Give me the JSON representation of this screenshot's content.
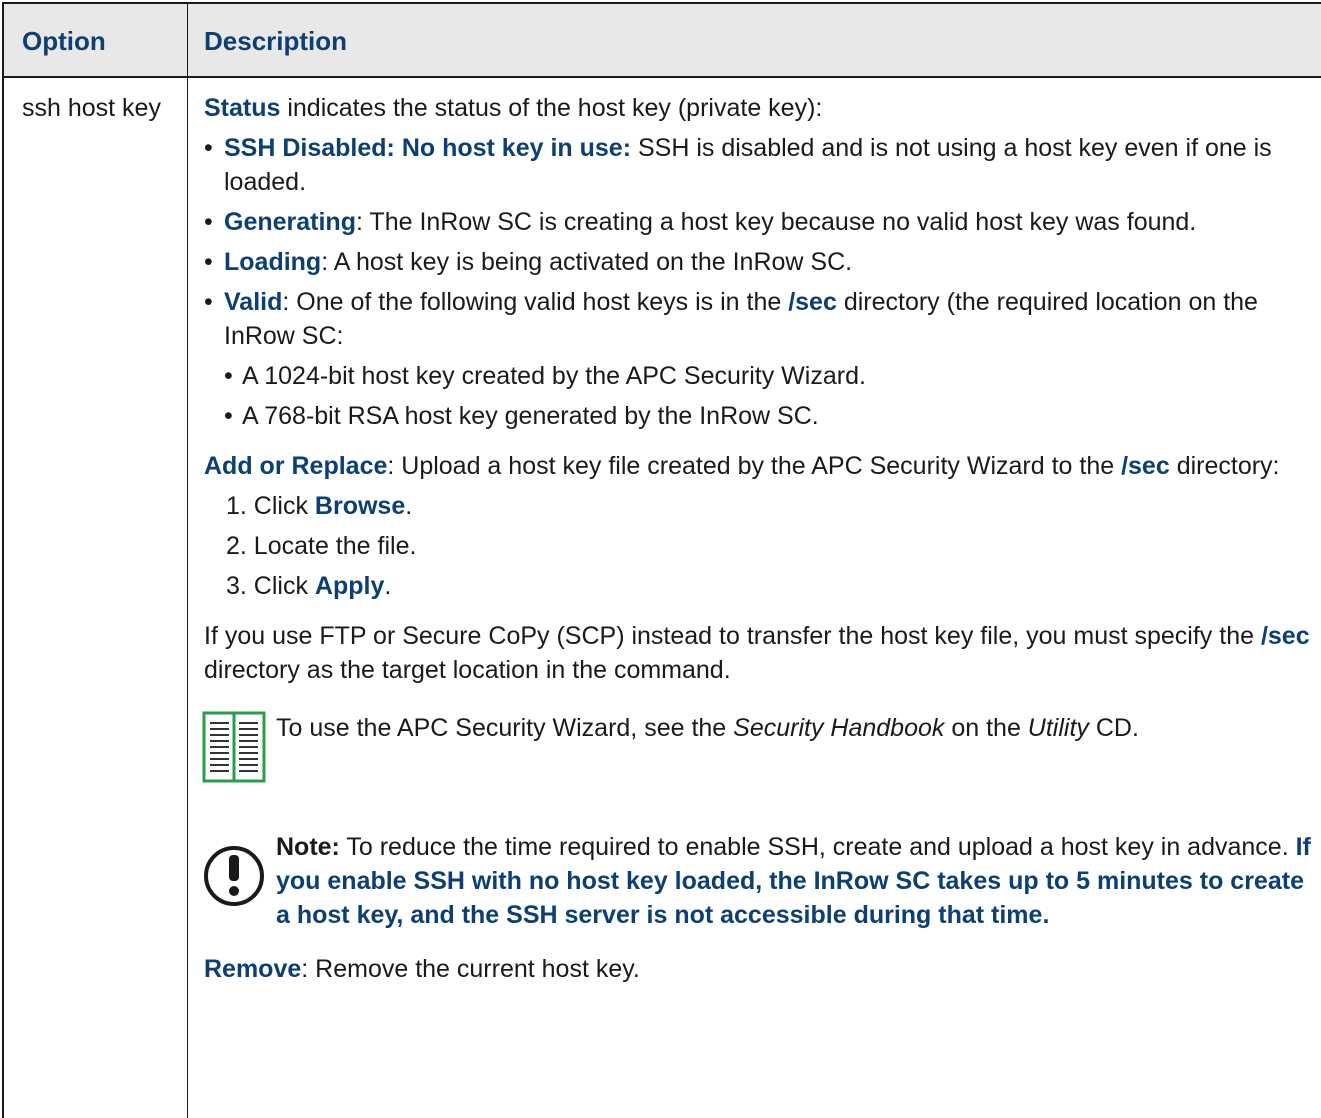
{
  "table": {
    "header_option": "Option",
    "header_description": "Description",
    "option_name": "ssh host key"
  },
  "status": {
    "term": "Status",
    "intro": " indicates the status of the host key (private key):",
    "items": [
      {
        "term": "SSH Disabled: No host key in use:",
        "text": " SSH is disabled and is not using a host key even if one is loaded."
      },
      {
        "term": "Generating",
        "text": ": The InRow SC is creating a host key because no valid host key was found."
      },
      {
        "term": "Loading",
        "text": ": A host key is being activated on the InRow SC."
      }
    ],
    "valid": {
      "term": "Valid",
      "text_before": ": One of the following valid host keys is in the ",
      "dir": "/sec",
      "text_after": " directory (the required location on the InRow SC:",
      "subitems": [
        "A 1024-bit host key created by the APC Security Wizard.",
        "A 768-bit RSA host key generated by the InRow SC."
      ]
    }
  },
  "add_replace": {
    "term": "Add or Replace",
    "text": ": Upload a host key file created by the APC Security Wizard to the ",
    "dir": "/sec",
    "text_after": " directory:",
    "steps": [
      {
        "num": "1.",
        "pre": " Click ",
        "bold": "Browse",
        "post": "."
      },
      {
        "num": "2.",
        "pre": " Locate the file.",
        "bold": "",
        "post": ""
      },
      {
        "num": "3.",
        "pre": " Click ",
        "bold": "Apply",
        "post": "."
      }
    ]
  },
  "ftp": {
    "text_before": "If you use FTP or Secure CoPy (SCP) instead to transfer the host key file, you must specify the ",
    "dir": "/sec",
    "text_after": " directory as the target location in the command."
  },
  "book_note": {
    "icon": "book-icon",
    "pre": "To use the APC Security Wizard, see the ",
    "italic1": "Security Handbook",
    "mid": " on the ",
    "italic2": "Utility",
    "post": " CD."
  },
  "caution_note": {
    "icon": "exclamation-icon",
    "label": "Note:",
    "text": " To reduce the time required to enable SSH, create and upload a host key in advance. ",
    "bold_text": "If you enable SSH with no host key loaded, the InRow SC takes up to 5 minutes to create a host key, and the SSH server is not accessible during that time."
  },
  "remove": {
    "term": "Remove",
    "text": ": Remove the current host key."
  },
  "colors": {
    "keyword": "#0c3f73",
    "book_icon": "#2a9d4a",
    "header_bg": "#e8e8e8"
  }
}
